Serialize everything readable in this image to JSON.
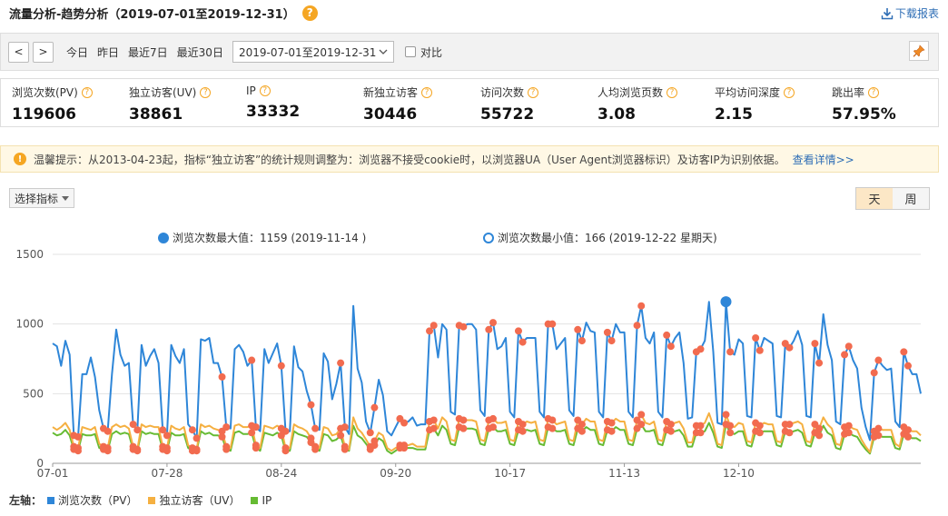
{
  "header": {
    "title": "流量分析-趋势分析（2019-07-01至2019-12-31）",
    "help": "?",
    "download": "下载报表"
  },
  "toolbar": {
    "prev": "<",
    "next": ">",
    "quick": [
      "今日",
      "昨日",
      "最近7日",
      "最近30日"
    ],
    "date_range": "2019-07-01至2019-12-31",
    "compare": "对比"
  },
  "metrics": [
    {
      "label": "浏览次数(PV)",
      "value": "119606"
    },
    {
      "label": "独立访客(UV)",
      "value": "38861"
    },
    {
      "label": "IP",
      "value": "33332"
    },
    {
      "label": "新独立访客",
      "value": "30446"
    },
    {
      "label": "访问次数",
      "value": "55722"
    },
    {
      "label": "人均浏览页数",
      "value": "3.08"
    },
    {
      "label": "平均访问深度",
      "value": "2.15"
    },
    {
      "label": "跳出率",
      "value": "57.95%"
    }
  ],
  "notice": {
    "text": "温馨提示：从2013-04-23起，指标“独立访客”的统计规则调整为：浏览器不接受cookie时，以浏览器UA（User Agent浏览器标识）及访客IP为识别依据。",
    "link": "查看详情>>"
  },
  "controls": {
    "metric_select": "选择指标",
    "period_day": "天",
    "period_week": "周"
  },
  "maxmin": {
    "max": "浏览次数最大值：1159 (2019-11-14 )",
    "min": "浏览次数最小值：166 (2019-12-22 星期天)"
  },
  "legend": {
    "title": "左轴：",
    "items": [
      {
        "name": "浏览次数（PV）",
        "color": "#2e86d8"
      },
      {
        "name": "独立访客（UV）",
        "color": "#f5b041"
      },
      {
        "name": "IP",
        "color": "#66bb33"
      }
    ]
  },
  "chart_data": {
    "type": "line",
    "start_date": "2019-07-01",
    "x_tick_labels": [
      "07-01",
      "07-28",
      "08-24",
      "09-20",
      "10-17",
      "11-13",
      "12-10"
    ],
    "ylim": [
      0,
      1500
    ],
    "y_ticks": [
      "0",
      "500",
      "1000",
      "1500"
    ],
    "grid": true,
    "colors": {
      "pv": "#2e86d8",
      "uv": "#f5b041",
      "ip": "#66bb33",
      "weekend_marker": "#f26b4f"
    },
    "series": [
      {
        "name": "浏览次数（PV）",
        "values": [
          860,
          840,
          700,
          880,
          780,
          200,
          190,
          640,
          640,
          760,
          620,
          380,
          250,
          230,
          640,
          960,
          780,
          700,
          720,
          280,
          240,
          850,
          700,
          770,
          820,
          720,
          240,
          200,
          850,
          770,
          720,
          820,
          280,
          240,
          180,
          890,
          880,
          900,
          720,
          720,
          620,
          260,
          250,
          820,
          850,
          800,
          700,
          740,
          260,
          230,
          820,
          720,
          790,
          860,
          700,
          230,
          230,
          840,
          690,
          660,
          520,
          420,
          250,
          240,
          790,
          730,
          460,
          570,
          720,
          260,
          210,
          1130,
          680,
          580,
          300,
          220,
          400,
          600,
          490,
          230,
          200,
          260,
          320,
          290,
          300,
          330,
          270,
          280,
          280,
          950,
          990,
          760,
          1000,
          960,
          370,
          350,
          990,
          980,
          1000,
          1000,
          960,
          380,
          340,
          960,
          1010,
          820,
          840,
          900,
          370,
          330,
          950,
          870,
          900,
          900,
          900,
          370,
          330,
          1000,
          1000,
          820,
          860,
          900,
          380,
          340,
          960,
          880,
          1010,
          950,
          940,
          370,
          330,
          940,
          880,
          1000,
          940,
          940,
          370,
          330,
          990,
          1130,
          900,
          860,
          940,
          370,
          330,
          920,
          840,
          900,
          940,
          720,
          320,
          330,
          800,
          820,
          880,
          1159,
          800,
          290,
          280,
          1160,
          800,
          780,
          890,
          860,
          340,
          330,
          900,
          810,
          900,
          880,
          860,
          340,
          330,
          860,
          830,
          880,
          950,
          850,
          340,
          330,
          860,
          720,
          1070,
          850,
          740,
          300,
          280,
          780,
          840,
          740,
          680,
          400,
          260,
          166,
          650,
          740,
          700,
          670,
          680,
          300,
          260,
          800,
          700,
          640,
          640,
          500
        ]
      },
      {
        "name": "独立访客（UV）",
        "values": [
          260,
          240,
          260,
          290,
          240,
          120,
          110,
          260,
          250,
          240,
          260,
          140,
          120,
          110,
          260,
          280,
          260,
          270,
          250,
          120,
          100,
          280,
          260,
          270,
          260,
          260,
          120,
          110,
          270,
          250,
          240,
          260,
          130,
          110,
          100,
          280,
          260,
          270,
          250,
          240,
          230,
          120,
          110,
          270,
          280,
          260,
          260,
          270,
          130,
          110,
          270,
          260,
          250,
          270,
          250,
          110,
          110,
          280,
          260,
          250,
          230,
          180,
          120,
          110,
          260,
          250,
          200,
          210,
          250,
          120,
          100,
          330,
          250,
          220,
          170,
          120,
          160,
          220,
          200,
          110,
          90,
          110,
          130,
          130,
          130,
          140,
          120,
          120,
          120,
          300,
          310,
          250,
          330,
          300,
          170,
          160,
          320,
          310,
          310,
          310,
          300,
          170,
          160,
          310,
          320,
          290,
          290,
          300,
          170,
          160,
          300,
          280,
          300,
          290,
          300,
          170,
          160,
          320,
          310,
          280,
          290,
          300,
          170,
          160,
          310,
          280,
          320,
          300,
          300,
          170,
          160,
          300,
          290,
          320,
          300,
          300,
          170,
          160,
          310,
          350,
          290,
          280,
          300,
          170,
          160,
          300,
          280,
          290,
          300,
          250,
          150,
          150,
          270,
          270,
          290,
          360,
          270,
          140,
          130,
          350,
          270,
          260,
          290,
          280,
          160,
          150,
          290,
          270,
          290,
          280,
          280,
          160,
          150,
          280,
          280,
          290,
          300,
          280,
          160,
          150,
          280,
          250,
          330,
          280,
          250,
          140,
          130,
          260,
          270,
          250,
          240,
          170,
          120,
          80,
          230,
          250,
          240,
          240,
          240,
          140,
          120,
          260,
          240,
          230,
          230,
          200
        ]
      },
      {
        "name": "IP",
        "values": [
          220,
          200,
          210,
          240,
          200,
          100,
          90,
          210,
          200,
          200,
          210,
          110,
          100,
          90,
          210,
          230,
          210,
          220,
          210,
          100,
          90,
          230,
          210,
          220,
          210,
          210,
          100,
          90,
          220,
          200,
          200,
          210,
          110,
          90,
          90,
          230,
          210,
          220,
          200,
          200,
          190,
          100,
          90,
          220,
          230,
          210,
          210,
          220,
          110,
          90,
          220,
          210,
          200,
          220,
          200,
          90,
          90,
          230,
          210,
          200,
          190,
          150,
          100,
          90,
          210,
          200,
          160,
          170,
          200,
          100,
          90,
          270,
          200,
          180,
          140,
          100,
          130,
          180,
          160,
          90,
          70,
          90,
          110,
          110,
          110,
          110,
          100,
          100,
          100,
          240,
          250,
          200,
          270,
          240,
          140,
          130,
          260,
          250,
          250,
          250,
          240,
          140,
          130,
          250,
          260,
          230,
          230,
          240,
          140,
          130,
          240,
          230,
          240,
          230,
          240,
          140,
          130,
          260,
          250,
          230,
          230,
          240,
          140,
          130,
          250,
          230,
          260,
          240,
          240,
          140,
          130,
          240,
          230,
          260,
          240,
          240,
          140,
          130,
          250,
          280,
          230,
          230,
          240,
          140,
          130,
          240,
          230,
          230,
          240,
          200,
          120,
          120,
          220,
          220,
          230,
          290,
          220,
          120,
          110,
          280,
          220,
          210,
          230,
          230,
          130,
          120,
          230,
          220,
          230,
          230,
          230,
          130,
          120,
          230,
          220,
          230,
          240,
          220,
          130,
          120,
          220,
          200,
          270,
          220,
          200,
          110,
          100,
          210,
          220,
          200,
          190,
          140,
          100,
          70,
          190,
          200,
          190,
          190,
          190,
          110,
          100,
          210,
          190,
          180,
          180,
          160
        ]
      }
    ]
  }
}
